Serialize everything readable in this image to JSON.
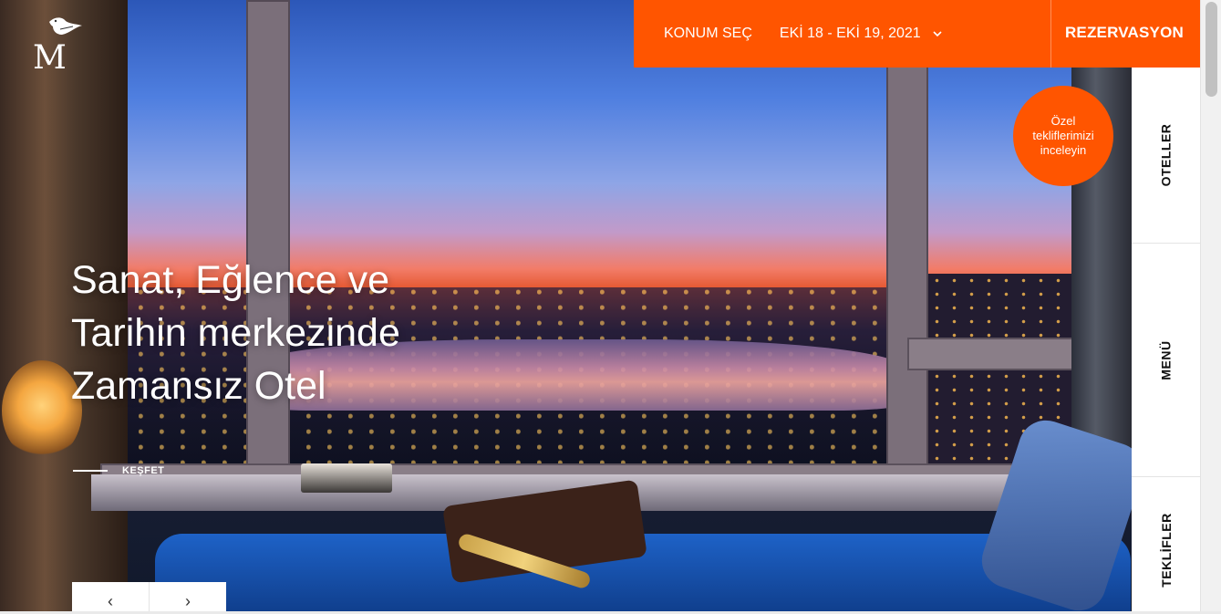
{
  "brand": {
    "logo_letter": "M"
  },
  "topbar": {
    "location_label": "KONUM SEÇ",
    "date_range": "EKİ 18 - EKİ 19, 2021",
    "reserve_label": "REZERVASYON",
    "accent_color": "#ff5500"
  },
  "offer_badge": {
    "text": "Özel tekliflerimizi inceleyin"
  },
  "side_menu": [
    {
      "label": "OTELLER"
    },
    {
      "label": "MENÜ"
    },
    {
      "label": "TEKLİFLER"
    }
  ],
  "hero": {
    "headline_line1": "Sanat, Eğlence ve",
    "headline_line2": "Tarihin merkezinde",
    "headline_line3": "Zamansız Otel",
    "explore_label": "KEŞFET"
  },
  "slider": {
    "prev_icon": "‹",
    "next_icon": "›"
  }
}
